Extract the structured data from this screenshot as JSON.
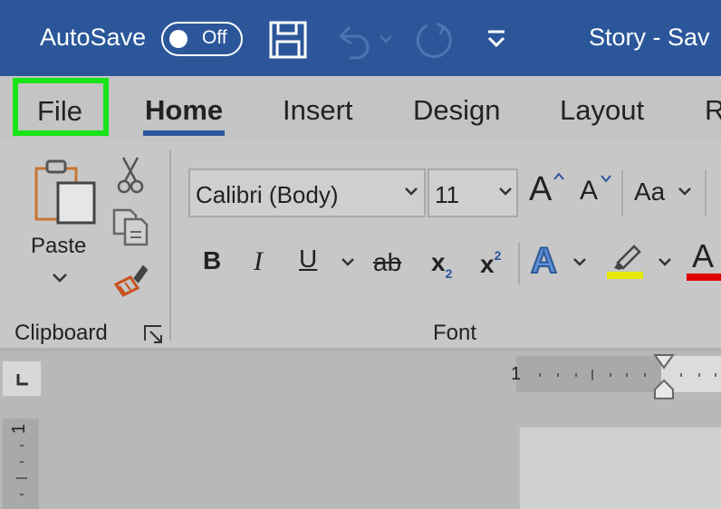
{
  "titlebar": {
    "autosave_label": "AutoSave",
    "autosave_state": "Off",
    "document_title": "Story  -  Sav",
    "icons": [
      "save-icon",
      "undo-icon",
      "redo-icon",
      "customize-quick-access-icon"
    ]
  },
  "tabs": [
    {
      "label": "File",
      "highlighted": true
    },
    {
      "label": "Home",
      "selected": true
    },
    {
      "label": "Insert"
    },
    {
      "label": "Design"
    },
    {
      "label": "Layout"
    },
    {
      "label": "R"
    }
  ],
  "clipboard": {
    "paste_label": "Paste",
    "group_label": "Clipboard",
    "icons": [
      "clipboard-icon",
      "cut-icon",
      "copy-icon",
      "format-painter-icon",
      "dialog-launcher-icon"
    ]
  },
  "font": {
    "font_name": "Calibri (Body)",
    "font_size": "11",
    "grow_label": "A",
    "shrink_label": "A",
    "change_case_label": "Aa",
    "bold": "B",
    "italic": "I",
    "underline": "U",
    "strikethrough": "ab",
    "subscript_base": "x",
    "subscript_digit": "2",
    "superscript_base": "x",
    "superscript_digit": "2",
    "text_effects": "A",
    "font_color": "A",
    "group_label": "Font"
  },
  "ruler": {
    "h_number": "1",
    "v_number": "1"
  },
  "colors": {
    "accent": "#2b579a",
    "highlight_border": "#18e418",
    "highlighter": "#e8e800",
    "font_color": "#e00000"
  }
}
